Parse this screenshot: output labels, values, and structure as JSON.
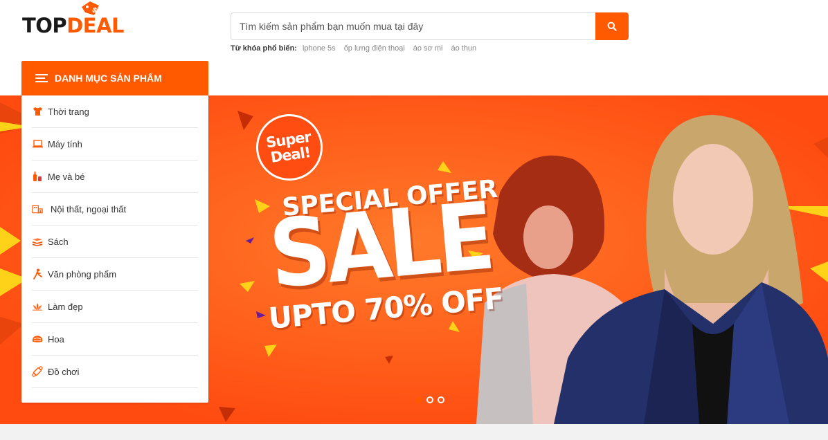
{
  "logo": {
    "part1": "TOP",
    "part2": "DEAL",
    "tag": "$"
  },
  "search": {
    "placeholder": "Tìm kiếm sản phẩm bạn muốn mua tại đây",
    "button_icon": "search-icon"
  },
  "keywords": {
    "label": "Từ khóa phổ biến:",
    "items": [
      "iphone 5s",
      "ốp lưng điện thoại",
      "áo sơ mi",
      "áo thun"
    ]
  },
  "category_menu": {
    "title": "DANH MỤC SẢN PHẨM",
    "items": [
      {
        "label": "Thời trang",
        "icon": "shirt-icon"
      },
      {
        "label": "Máy tính",
        "icon": "laptop-icon"
      },
      {
        "label": "Mẹ và bé",
        "icon": "baby-bottle-icon"
      },
      {
        "label": "Nội thất, ngoại thất",
        "icon": "furniture-icon"
      },
      {
        "label": "Sách",
        "icon": "books-icon"
      },
      {
        "label": "Văn phòng phẩm",
        "icon": "stationery-icon"
      },
      {
        "label": "Làm đẹp",
        "icon": "lotus-icon"
      },
      {
        "label": "Hoa",
        "icon": "flower-icon"
      },
      {
        "label": "Đồ chơi",
        "icon": "toy-icon"
      }
    ]
  },
  "banner": {
    "badge_line1": "Super",
    "badge_line2": "Deal!",
    "headline": "SPECIAL OFFER",
    "main": "SALE",
    "sub": "UPTO 70% OFF",
    "slides": 3,
    "active_slide": 1
  },
  "colors": {
    "accent": "#ff5a00",
    "banner": "#ff5a1a",
    "yellow": "#ffd21a",
    "purple": "#6a1b9a"
  }
}
